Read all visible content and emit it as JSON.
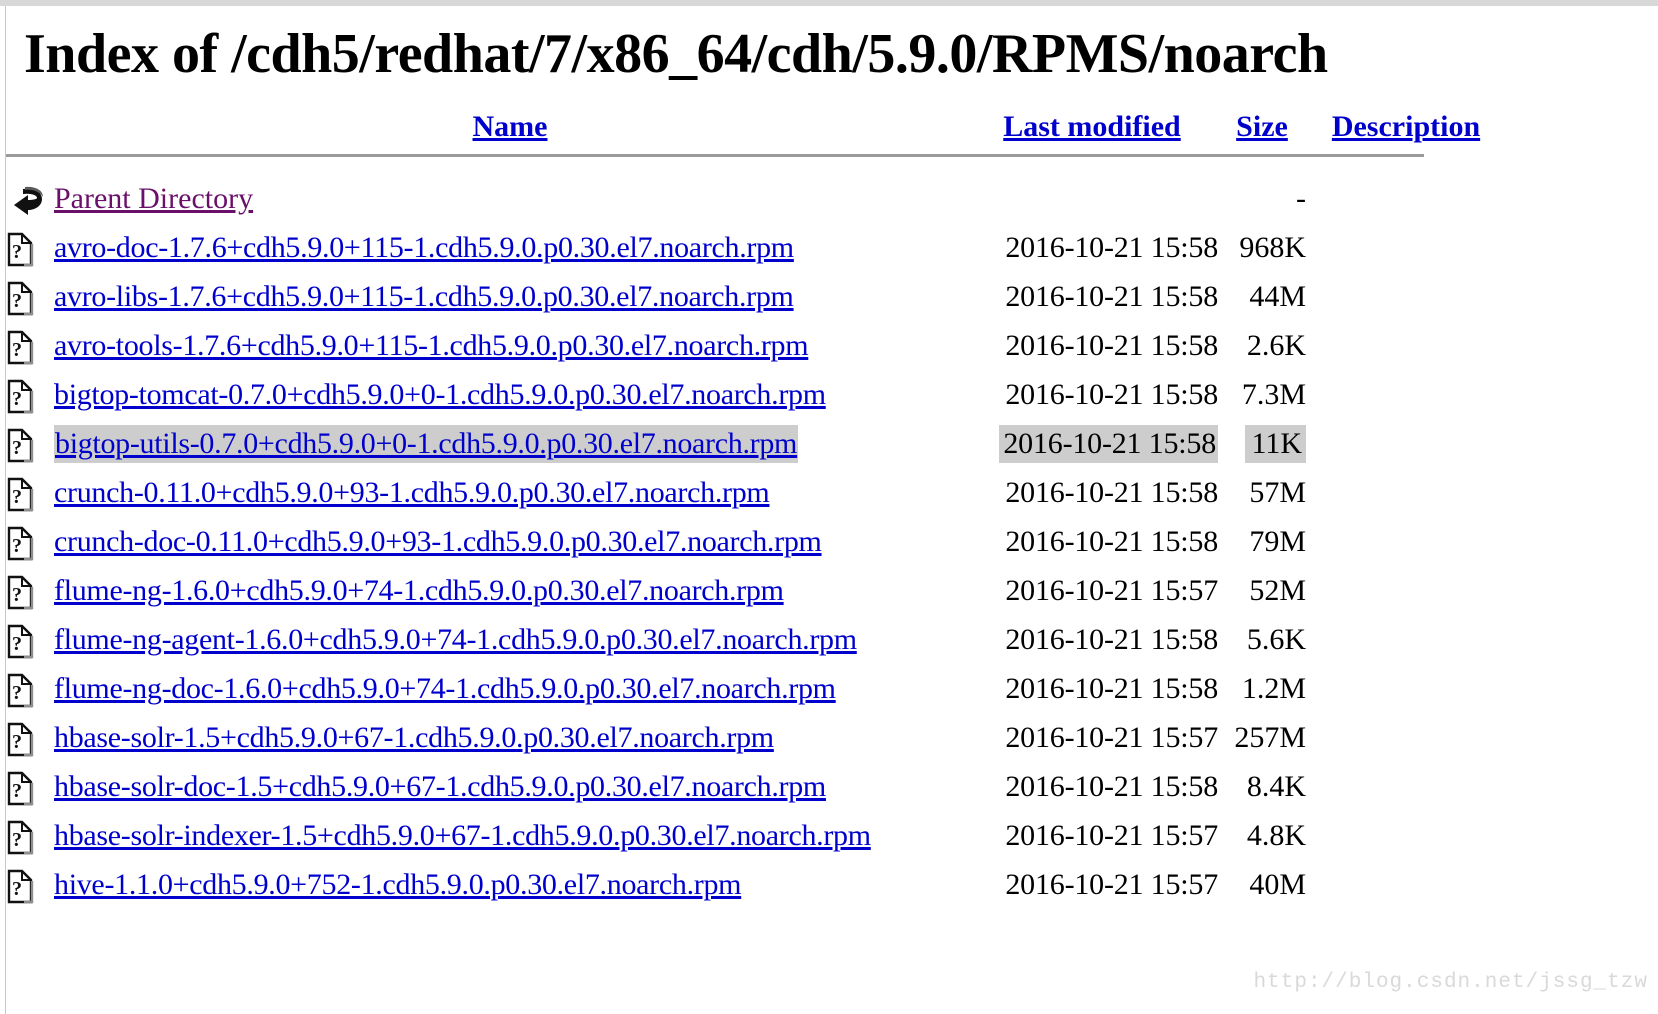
{
  "page": {
    "title": "Index of /cdh5/redhat/7/x86_64/cdh/5.9.0/RPMS/noarch",
    "watermark": "http://blog.csdn.net/jssg_tzw"
  },
  "colors": {
    "link": "#0000cc",
    "visited_link": "#6a0f6a",
    "selection": "#cdcdcd",
    "rule": "#9a9a9a",
    "text": "#000000"
  },
  "headers": {
    "name": "Name",
    "last_modified": "Last modified",
    "size": "Size",
    "description": "Description"
  },
  "parent": {
    "icon": "back-arrow-icon",
    "label": "Parent Directory",
    "last_modified": "",
    "size": "-",
    "description": ""
  },
  "rows": [
    {
      "icon": "unknown-file-icon",
      "name": "avro-doc-1.7.6+cdh5.9.0+115-1.cdh5.9.0.p0.30.el7.noarch.rpm",
      "last_modified": "2016-10-21 15:58",
      "size": "968K",
      "description": "",
      "selected": false
    },
    {
      "icon": "unknown-file-icon",
      "name": "avro-libs-1.7.6+cdh5.9.0+115-1.cdh5.9.0.p0.30.el7.noarch.rpm",
      "last_modified": "2016-10-21 15:58",
      "size": "44M",
      "description": "",
      "selected": false
    },
    {
      "icon": "unknown-file-icon",
      "name": "avro-tools-1.7.6+cdh5.9.0+115-1.cdh5.9.0.p0.30.el7.noarch.rpm",
      "last_modified": "2016-10-21 15:58",
      "size": "2.6K",
      "description": "",
      "selected": false
    },
    {
      "icon": "unknown-file-icon",
      "name": "bigtop-tomcat-0.7.0+cdh5.9.0+0-1.cdh5.9.0.p0.30.el7.noarch.rpm",
      "last_modified": "2016-10-21 15:58",
      "size": "7.3M",
      "description": "",
      "selected": false
    },
    {
      "icon": "unknown-file-icon",
      "name": "bigtop-utils-0.7.0+cdh5.9.0+0-1.cdh5.9.0.p0.30.el7.noarch.rpm",
      "last_modified": "2016-10-21 15:58",
      "size": "11K",
      "description": "",
      "selected": true
    },
    {
      "icon": "unknown-file-icon",
      "name": "crunch-0.11.0+cdh5.9.0+93-1.cdh5.9.0.p0.30.el7.noarch.rpm",
      "last_modified": "2016-10-21 15:58",
      "size": "57M",
      "description": "",
      "selected": false
    },
    {
      "icon": "unknown-file-icon",
      "name": "crunch-doc-0.11.0+cdh5.9.0+93-1.cdh5.9.0.p0.30.el7.noarch.rpm",
      "last_modified": "2016-10-21 15:58",
      "size": "79M",
      "description": "",
      "selected": false
    },
    {
      "icon": "unknown-file-icon",
      "name": "flume-ng-1.6.0+cdh5.9.0+74-1.cdh5.9.0.p0.30.el7.noarch.rpm",
      "last_modified": "2016-10-21 15:57",
      "size": "52M",
      "description": "",
      "selected": false
    },
    {
      "icon": "unknown-file-icon",
      "name": "flume-ng-agent-1.6.0+cdh5.9.0+74-1.cdh5.9.0.p0.30.el7.noarch.rpm",
      "last_modified": "2016-10-21 15:58",
      "size": "5.6K",
      "description": "",
      "selected": false
    },
    {
      "icon": "unknown-file-icon",
      "name": "flume-ng-doc-1.6.0+cdh5.9.0+74-1.cdh5.9.0.p0.30.el7.noarch.rpm",
      "last_modified": "2016-10-21 15:58",
      "size": "1.2M",
      "description": "",
      "selected": false
    },
    {
      "icon": "unknown-file-icon",
      "name": "hbase-solr-1.5+cdh5.9.0+67-1.cdh5.9.0.p0.30.el7.noarch.rpm",
      "last_modified": "2016-10-21 15:57",
      "size": "257M",
      "description": "",
      "selected": false
    },
    {
      "icon": "unknown-file-icon",
      "name": "hbase-solr-doc-1.5+cdh5.9.0+67-1.cdh5.9.0.p0.30.el7.noarch.rpm",
      "last_modified": "2016-10-21 15:58",
      "size": "8.4K",
      "description": "",
      "selected": false
    },
    {
      "icon": "unknown-file-icon",
      "name": "hbase-solr-indexer-1.5+cdh5.9.0+67-1.cdh5.9.0.p0.30.el7.noarch.rpm",
      "last_modified": "2016-10-21 15:57",
      "size": "4.8K",
      "description": "",
      "selected": false
    },
    {
      "icon": "unknown-file-icon",
      "name": "hive-1.1.0+cdh5.9.0+752-1.cdh5.9.0.p0.30.el7.noarch.rpm",
      "last_modified": "2016-10-21 15:57",
      "size": "40M",
      "description": "",
      "selected": false
    }
  ]
}
